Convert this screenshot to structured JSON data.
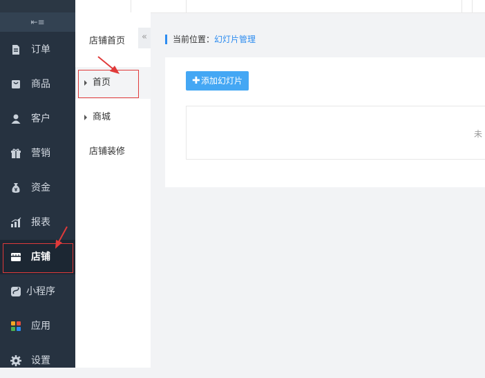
{
  "sidebar": {
    "collapse_glyph": "⇤≡",
    "items": [
      {
        "label": "订单",
        "icon": "document-icon"
      },
      {
        "label": "商品",
        "icon": "bag-icon"
      },
      {
        "label": "客户",
        "icon": "user-icon"
      },
      {
        "label": "营销",
        "icon": "gift-icon"
      },
      {
        "label": "资金",
        "icon": "money-bag-icon"
      },
      {
        "label": "报表",
        "icon": "bar-chart-icon"
      },
      {
        "label": "店铺",
        "icon": "store-icon",
        "active": true
      },
      {
        "label": "小程序",
        "icon": "mini-program-icon"
      },
      {
        "label": "应用",
        "icon": "apps-grid-icon"
      },
      {
        "label": "设置",
        "icon": "gear-icon"
      }
    ]
  },
  "subnav": {
    "title": "店铺首页",
    "collapse_glyph": "«",
    "items": [
      {
        "label": "首页",
        "expandable": true,
        "selected": true
      },
      {
        "label": "商城",
        "expandable": true
      },
      {
        "label": "店铺装修",
        "expandable": false
      }
    ]
  },
  "breadcrumb": {
    "prefix": "当前位置：",
    "current": "幻灯片管理"
  },
  "content": {
    "add_button_label": "添加幻灯片",
    "empty_text": "未"
  },
  "colors": {
    "sidebar_bg": "#263240",
    "accent_blue": "#2d8cf0",
    "button_blue": "#44a7f4",
    "annotation_red": "#e03a3a"
  }
}
